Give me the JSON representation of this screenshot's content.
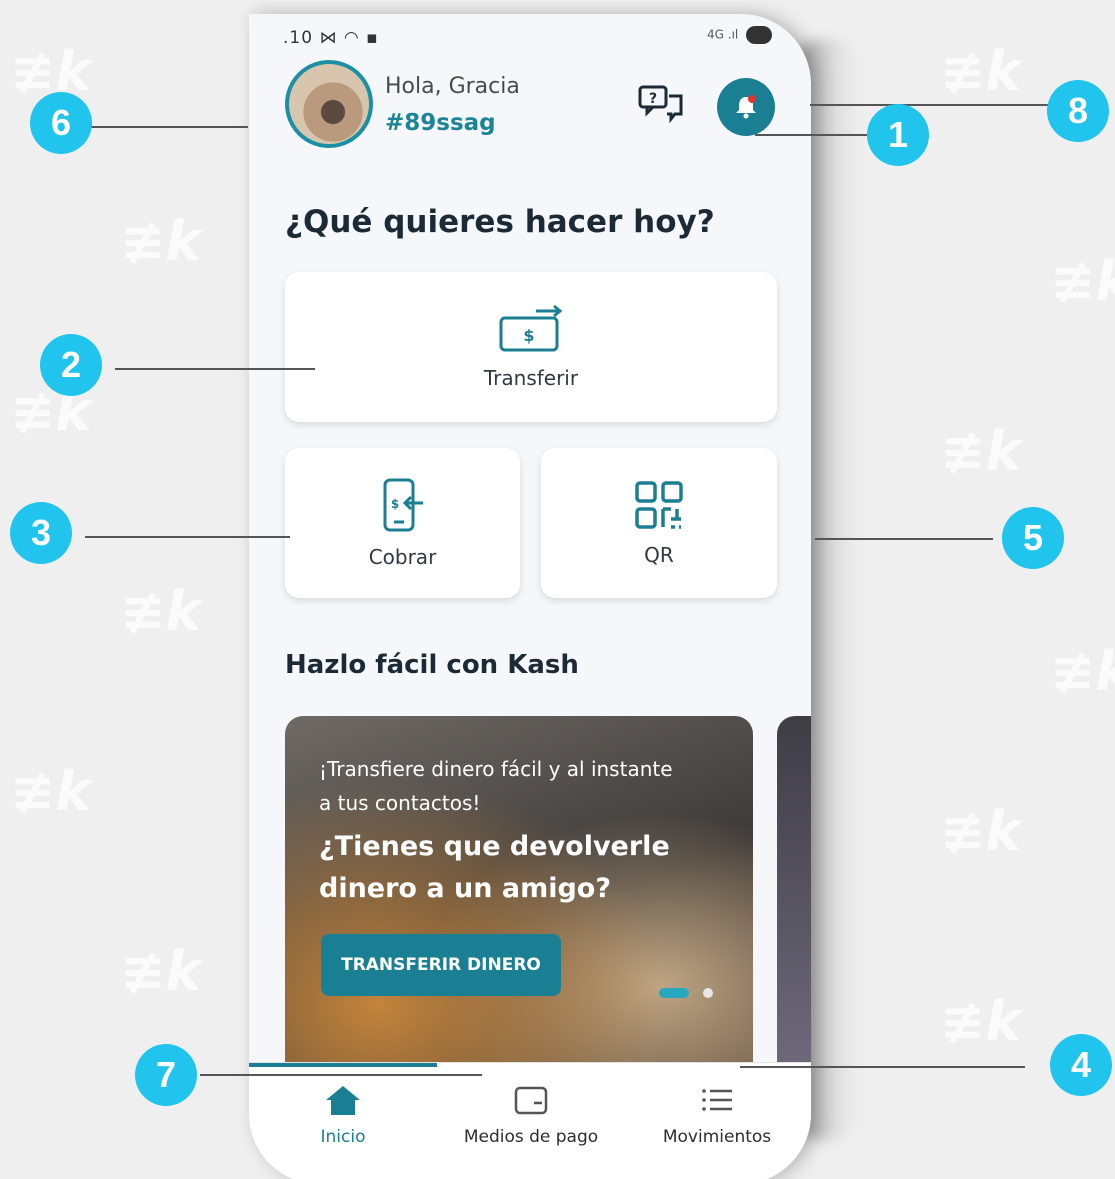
{
  "status_bar": {
    "left": ".10 ⋈ ◠ ▪",
    "right": "4G .ıl"
  },
  "header": {
    "greeting": "Hola, Gracia",
    "user_code": "#89ssag"
  },
  "icons": {
    "chat": "chat-question-icon",
    "bell": "bell-icon",
    "transfer": "money-transfer-icon",
    "cobrar": "phone-request-icon",
    "qr": "qr-code-icon",
    "home": "home-icon",
    "wallet": "wallet-icon",
    "list": "list-icon"
  },
  "main": {
    "heading": "¿Qué quieres hacer hoy?",
    "actions": {
      "transfer": "Transferir",
      "cobrar": "Cobrar",
      "qr": "QR"
    },
    "section_title": "Hazlo fácil con Kash",
    "promo": {
      "line1": "¡Transfiere dinero fácil y al instante a tus contactos!",
      "line2": "¿Tienes que devolverle dinero a un amigo?",
      "cta": "TRANSFERIR DINERO"
    }
  },
  "bottom_nav": {
    "items": [
      "Inicio",
      "Medios de pago",
      "Movimientos"
    ],
    "active": "Inicio"
  },
  "annotations": [
    "1",
    "2",
    "3",
    "4",
    "5",
    "6",
    "7",
    "8"
  ],
  "colors": {
    "accent": "#1b7f93",
    "annotation": "#21c4ec",
    "background": "#efefef"
  }
}
